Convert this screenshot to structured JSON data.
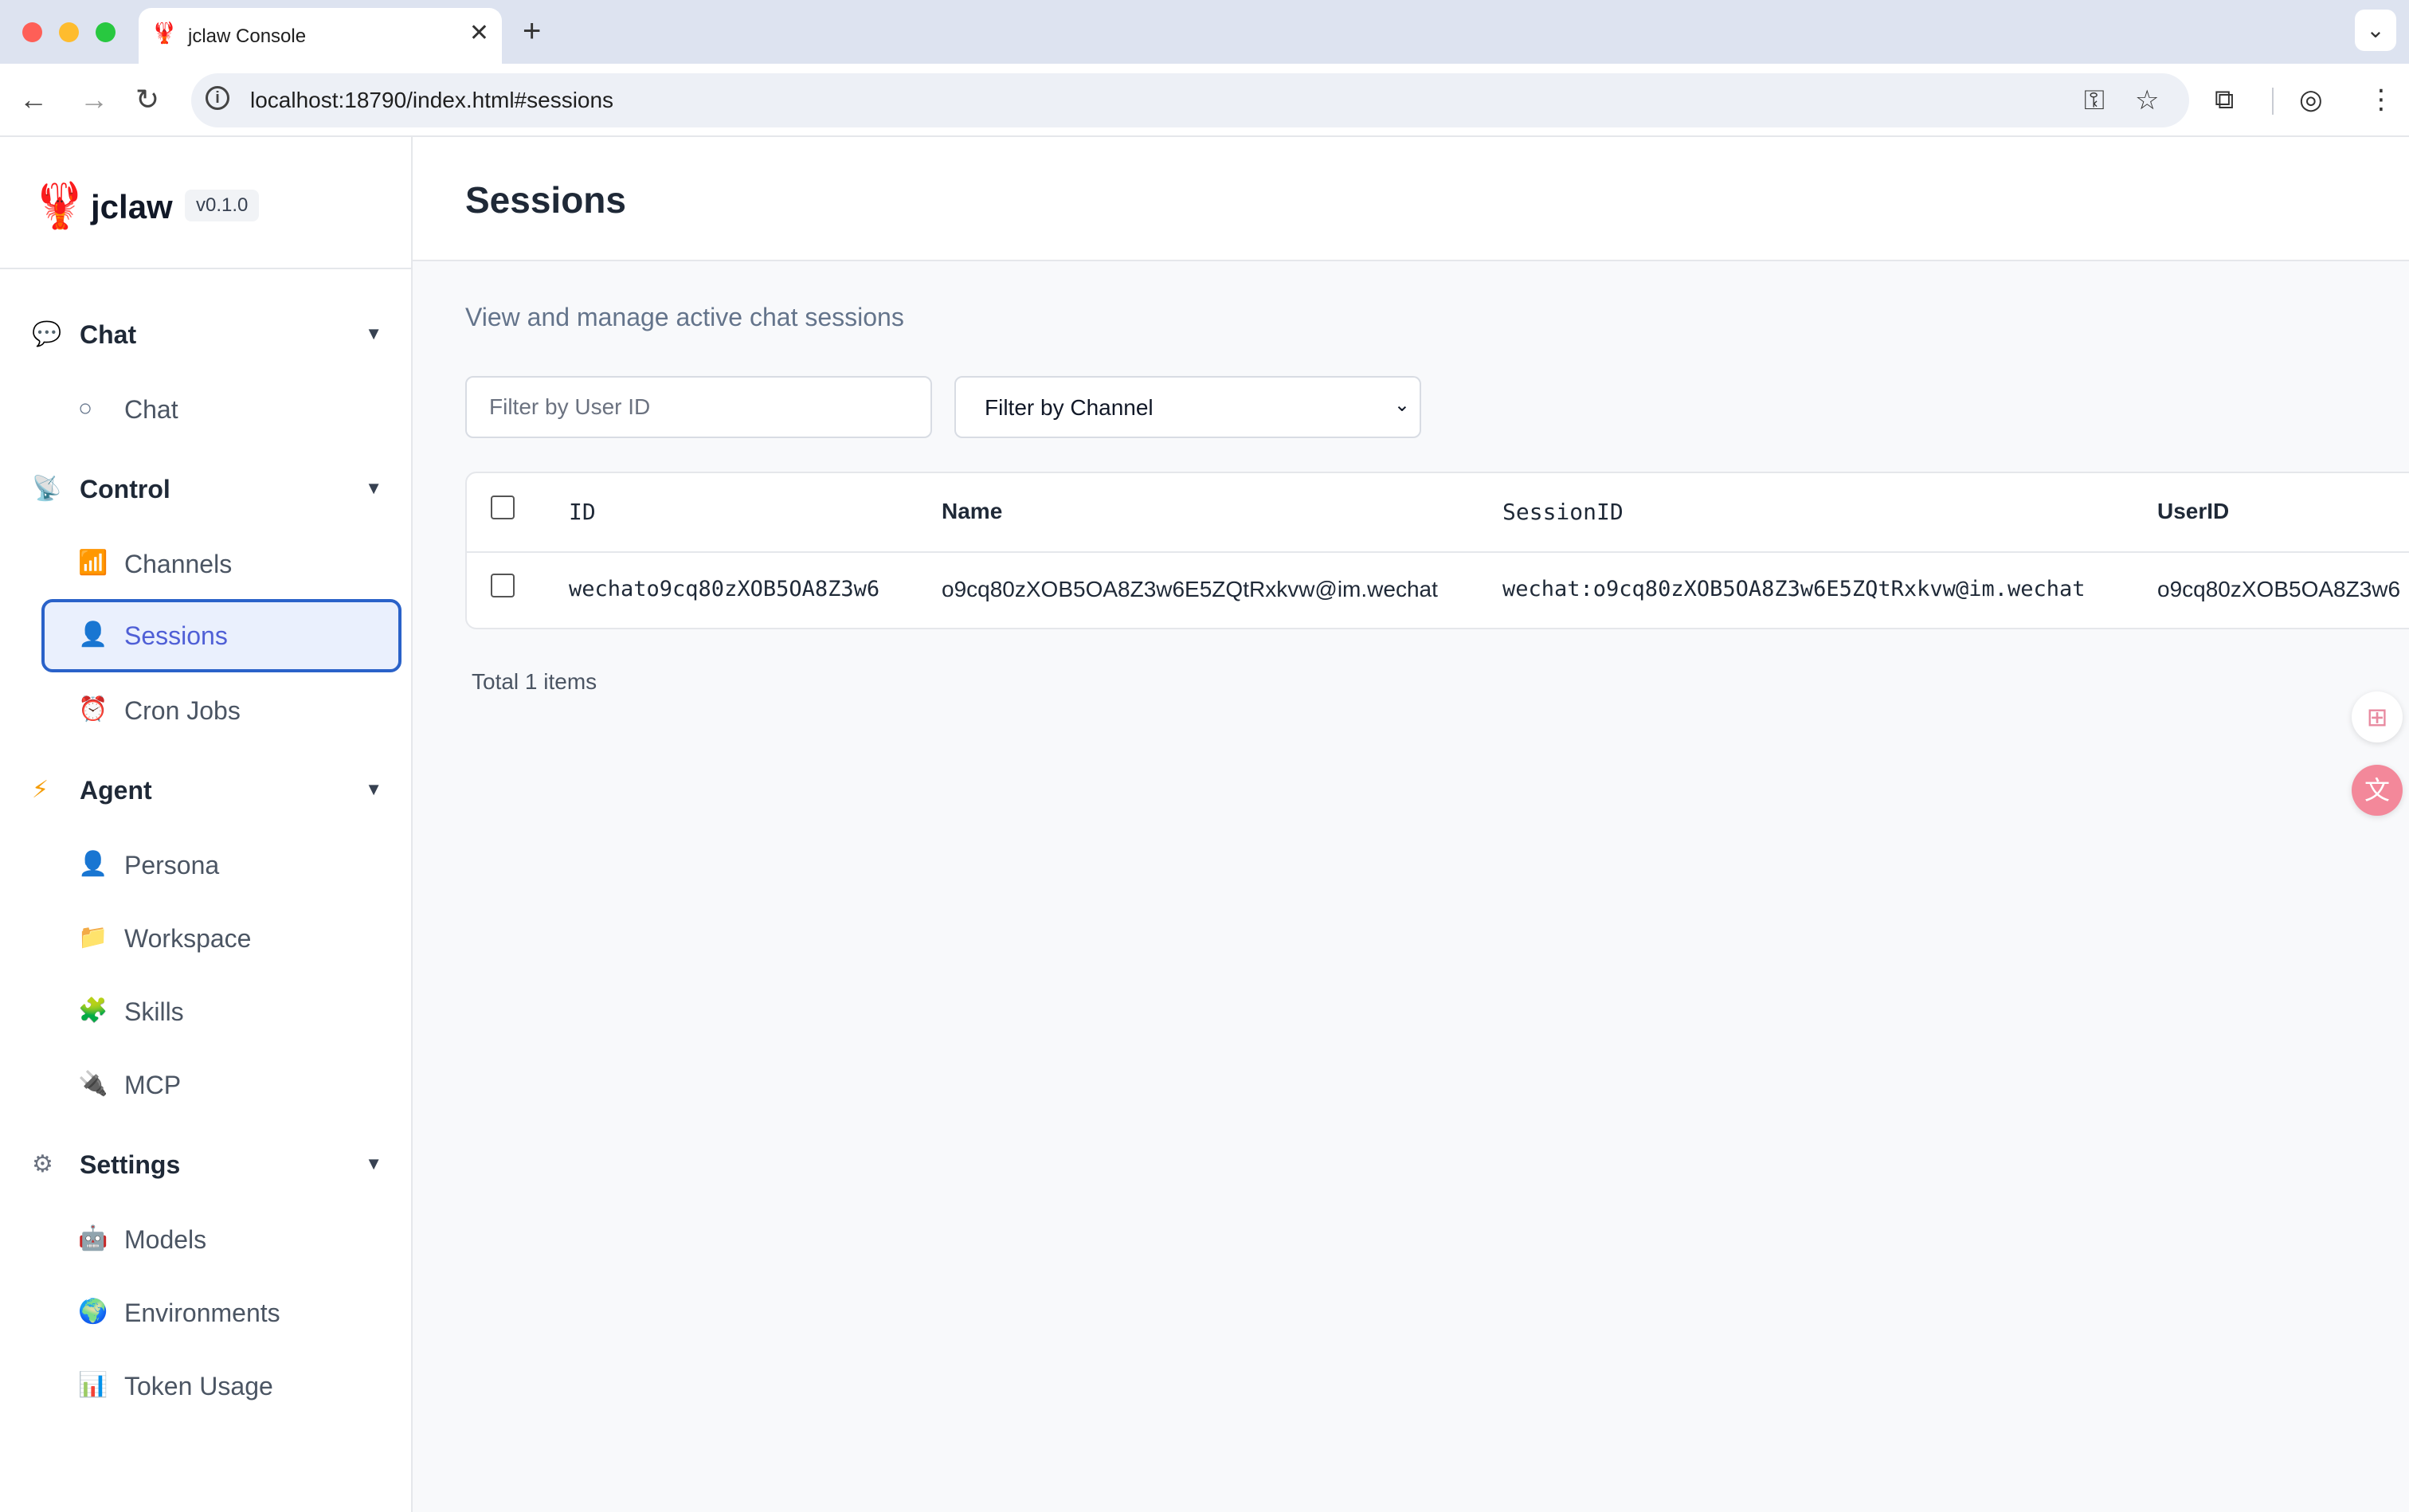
{
  "browser": {
    "tab_title": "jclaw Console",
    "tab_favicon": "🦞",
    "tab_close": "✕",
    "new_tab": "+",
    "tab_menu": "⌄",
    "url": "localhost:18790/index.html#sessions",
    "icons": [
      "back-arrow-icon",
      "forward-arrow-icon",
      "reload-icon",
      "site-info-icon",
      "key-icon",
      "star-icon",
      "extensions-icon",
      "profile-icon",
      "kebab-menu-icon"
    ]
  },
  "sidebar": {
    "brand": {
      "name": "jclaw",
      "version": "v0.1.0",
      "logo": "🦞"
    },
    "groups": [
      {
        "label": "Chat",
        "icon": "💬",
        "caret": "▼",
        "items": [
          {
            "label": "Chat",
            "icon": "○"
          }
        ]
      },
      {
        "label": "Control",
        "icon": "📡",
        "caret": "▼",
        "items": [
          {
            "label": "Channels",
            "icon": "📶"
          },
          {
            "label": "Sessions",
            "icon": "👤",
            "active": true
          },
          {
            "label": "Cron Jobs",
            "icon": "⏰"
          }
        ]
      },
      {
        "label": "Agent",
        "icon": "⚡",
        "caret": "▼",
        "items": [
          {
            "label": "Persona",
            "icon": "👤"
          },
          {
            "label": "Workspace",
            "icon": "📁"
          },
          {
            "label": "Skills",
            "icon": "🧩"
          },
          {
            "label": "MCP",
            "icon": "🔌"
          }
        ]
      },
      {
        "label": "Settings",
        "icon": "⚙",
        "caret": "▼",
        "items": [
          {
            "label": "Models",
            "icon": "🤖"
          },
          {
            "label": "Environments",
            "icon": "🌍"
          },
          {
            "label": "Token Usage",
            "icon": "📊"
          }
        ]
      }
    ]
  },
  "main": {
    "title": "Sessions",
    "subtitle": "View and manage active chat sessions",
    "filters": {
      "user_placeholder": "Filter by User ID",
      "channel_value": "Filter by Channel"
    },
    "table": {
      "columns": [
        "ID",
        "Name",
        "SessionID",
        "UserID"
      ],
      "rows": [
        [
          "wechato9cq80zXOB5OA8Z3w6",
          "o9cq80zXOB5OA8Z3w6E5ZQtRxkvw@im.wechat",
          "wechat:o9cq80zXOB5OA8Z3w6E5ZQtRxkvw@im.wechat",
          "o9cq80zXOB5OA8Z3w6"
        ]
      ]
    },
    "total": "Total 1 items"
  },
  "colors": {
    "accent": "#2a62c9",
    "active_bg": "#eaf0fd",
    "active_text": "#4f5fd6",
    "main_bg": "#f8f9fb"
  }
}
